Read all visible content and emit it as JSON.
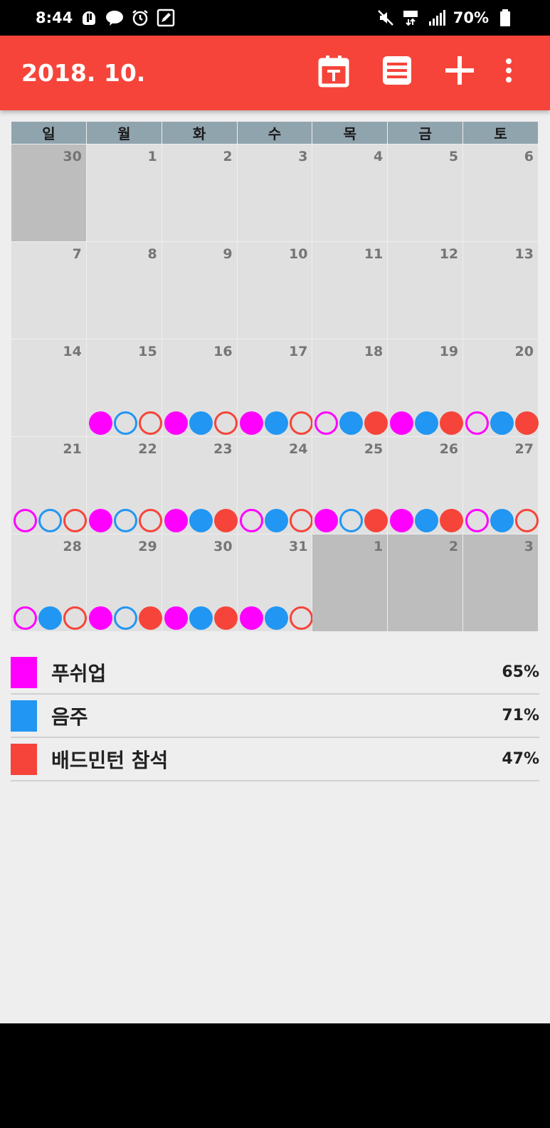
{
  "status": {
    "time": "8:44",
    "battery": "70%"
  },
  "header": {
    "title": "2018. 10."
  },
  "weekdays": [
    "일",
    "월",
    "화",
    "수",
    "목",
    "금",
    "토"
  ],
  "calendar": {
    "cells": [
      {
        "n": "30",
        "other": true
      },
      {
        "n": "1"
      },
      {
        "n": "2"
      },
      {
        "n": "3"
      },
      {
        "n": "4"
      },
      {
        "n": "5"
      },
      {
        "n": "6"
      },
      {
        "n": "7"
      },
      {
        "n": "8"
      },
      {
        "n": "9"
      },
      {
        "n": "10"
      },
      {
        "n": "11"
      },
      {
        "n": "12"
      },
      {
        "n": "13"
      },
      {
        "n": "14"
      },
      {
        "n": "15",
        "dots": "foo"
      },
      {
        "n": "16",
        "dots": "ffo"
      },
      {
        "n": "17",
        "dots": "ffo"
      },
      {
        "n": "18",
        "dots": "off"
      },
      {
        "n": "19",
        "dots": "fff"
      },
      {
        "n": "20",
        "dots": "off"
      },
      {
        "n": "21",
        "dots": "ooo"
      },
      {
        "n": "22",
        "dots": "foo"
      },
      {
        "n": "23",
        "dots": "fff"
      },
      {
        "n": "24",
        "dots": "ofo"
      },
      {
        "n": "25",
        "dots": "fof"
      },
      {
        "n": "26",
        "dots": "fff"
      },
      {
        "n": "27",
        "dots": "ofo"
      },
      {
        "n": "28",
        "dots": "ofo"
      },
      {
        "n": "29",
        "dots": "fof"
      },
      {
        "n": "30",
        "dots": "fff"
      },
      {
        "n": "31",
        "dots": "ffo"
      },
      {
        "n": "1",
        "other": true
      },
      {
        "n": "2",
        "other": true
      },
      {
        "n": "3",
        "other": true
      }
    ]
  },
  "legend": [
    {
      "label": "푸쉬업",
      "pct": "65%",
      "color": "#FF00FF"
    },
    {
      "label": "음주",
      "pct": "71%",
      "color": "#2196F3"
    },
    {
      "label": "배드민턴 참석",
      "pct": "47%",
      "color": "#F6443A"
    }
  ],
  "colors": {
    "accent": "#F6443A",
    "magenta": "#FF00FF",
    "blue": "#2196F3",
    "header_row": "#90A4AE",
    "cell": "#E0E0E0",
    "cell_other": "#BDBDBD"
  }
}
